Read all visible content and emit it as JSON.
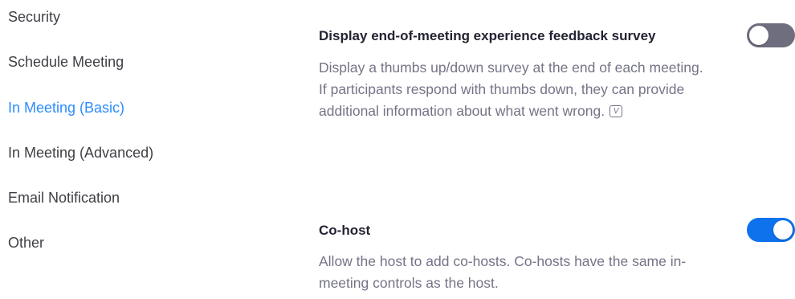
{
  "sidebar": {
    "items": [
      {
        "label": "Security",
        "active": false
      },
      {
        "label": "Schedule Meeting",
        "active": false
      },
      {
        "label": "In Meeting (Basic)",
        "active": true
      },
      {
        "label": "In Meeting (Advanced)",
        "active": false
      },
      {
        "label": "Email Notification",
        "active": false
      },
      {
        "label": "Other",
        "active": false
      }
    ]
  },
  "settings": [
    {
      "title": "Display end-of-meeting experience feedback survey",
      "description": "Display a thumbs up/down survey at the end of each meeting. If participants respond with thumbs down, they can provide additional information about what went wrong.",
      "info_icon": "v-version-icon",
      "info_icon_glyph": "V",
      "enabled": false
    },
    {
      "title": "Co-host",
      "description": "Allow the host to add co-hosts. Co-hosts have the same in-meeting controls as the host.",
      "enabled": true
    }
  ],
  "colors": {
    "accent": "#2d8cff",
    "toggle_on": "#0e72ed",
    "toggle_off": "#6e6e7e",
    "text_primary": "#232333",
    "text_secondary": "#747487"
  }
}
